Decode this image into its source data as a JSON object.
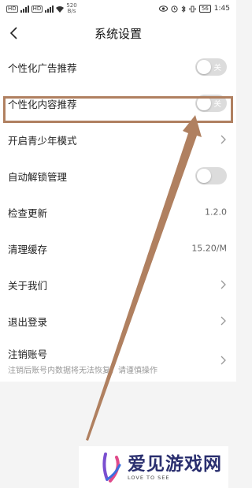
{
  "status_bar": {
    "sim1": "HD",
    "sim2": "HD",
    "speed_value": "520",
    "speed_unit": "B/s",
    "battery": "56",
    "time": "1:45"
  },
  "nav": {
    "title": "系统设置",
    "back_icon": "chevron-left-icon"
  },
  "settings": [
    {
      "label": "个性化广告推荐",
      "toggle_text": "关"
    },
    {
      "label": "个性化内容推荐",
      "toggle_text": "关"
    },
    {
      "label": "开启青少年模式"
    },
    {
      "label": "自动解锁管理"
    },
    {
      "label": "检查更新",
      "value": "1.2.0"
    },
    {
      "label": "清理缓存",
      "value": "15.20/M"
    },
    {
      "label": "关于我们"
    },
    {
      "label": "退出登录"
    },
    {
      "label": "注销账号",
      "sub": "注销后账号内数据将无法恢复，请谨慎操作"
    }
  ],
  "colors": {
    "highlight": "#b08060",
    "toggle_off": "#dcdcdc",
    "watermark_text": "#2a2f6f"
  },
  "watermark": {
    "cn": "爱见游戏网",
    "en": "LOVE TO SEE"
  }
}
